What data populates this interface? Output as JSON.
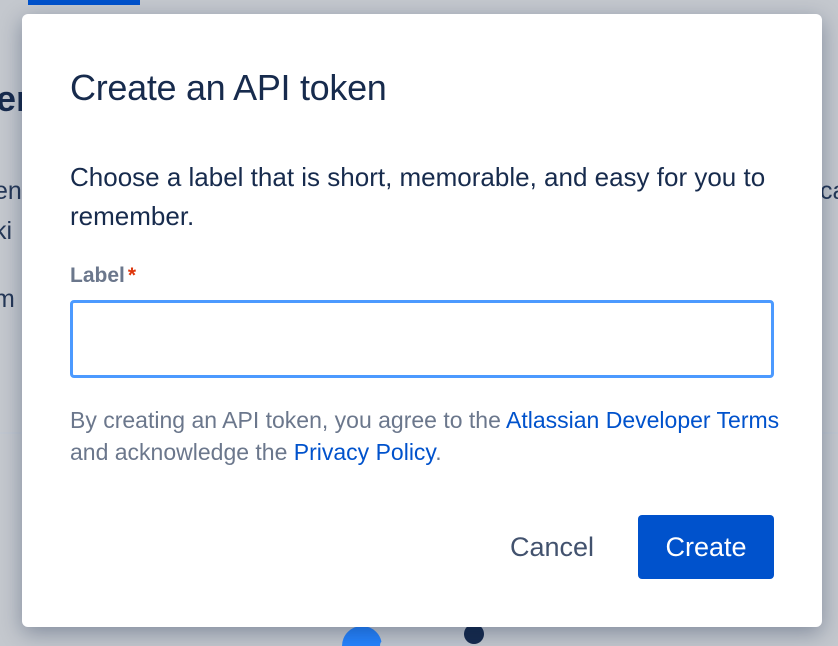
{
  "modal": {
    "title": "Create an API token",
    "description": "Choose a label that is short, memorable, and easy for you to remember.",
    "field": {
      "label": "Label",
      "required_marker": "*",
      "value": "",
      "placeholder": ""
    },
    "terms": {
      "prefix": "By creating an API token, you agree to the ",
      "developer_terms_link": "Atlassian Developer Terms",
      "middle": " and acknowledge the ",
      "privacy_link": "Privacy Policy",
      "suffix": "."
    },
    "cancel_label": "Cancel",
    "create_label": "Create"
  },
  "colors": {
    "primary": "#0052cc",
    "focus_border": "#4c9aff",
    "required": "#de350b",
    "text_dark": "#172b4d",
    "text_subtle": "#6b778c"
  }
}
